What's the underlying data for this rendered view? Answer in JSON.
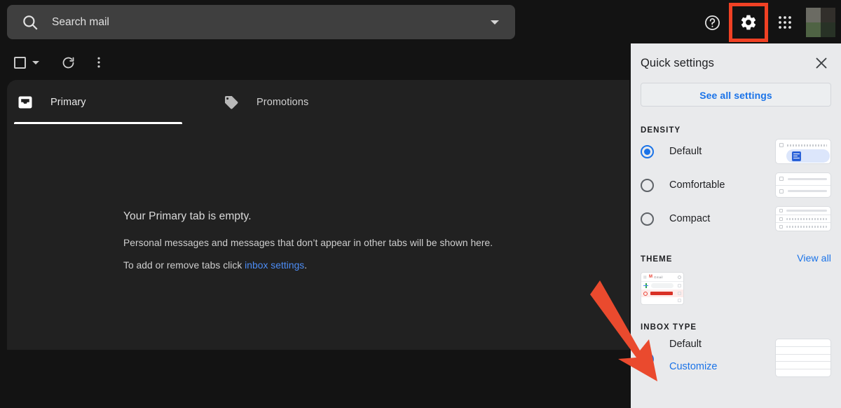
{
  "topbar": {
    "search": {
      "placeholder": "Search mail",
      "value": "",
      "icon": "search-icon"
    },
    "search_options_icon": "chevron-down-icon",
    "help_icon": "help-circle-icon",
    "settings_icon": "gear-icon",
    "apps_icon": "apps-grid-icon",
    "avatar_label": "",
    "highlight_color": "#f04124"
  },
  "toolbar": {
    "select_all_icon": "checkbox-icon",
    "select_all_caret_icon": "chevron-down-icon",
    "refresh_icon": "refresh-icon",
    "more_icon": "more-vertical-icon"
  },
  "tabs": [
    {
      "label": "Primary",
      "icon": "inbox-icon",
      "active": true
    },
    {
      "label": "Promotions",
      "icon": "tag-icon",
      "active": false
    }
  ],
  "empty_state": {
    "title": "Your Primary tab is empty.",
    "line2": "Personal messages and messages that don’t appear in other tabs will be shown here.",
    "line3_prefix": "To add or remove tabs click ",
    "line3_link": "inbox settings",
    "line3_suffix": "."
  },
  "quick_settings": {
    "title": "Quick settings",
    "close_icon": "close-icon",
    "see_all_label": "See all settings",
    "density": {
      "label": "DENSITY",
      "options": [
        {
          "label": "Default",
          "selected": true
        },
        {
          "label": "Comfortable",
          "selected": false
        },
        {
          "label": "Compact",
          "selected": false
        }
      ]
    },
    "theme": {
      "label": "THEME",
      "view_all_label": "View all",
      "preview_brand": "M",
      "preview_name": "Gmail"
    },
    "inbox_type": {
      "label": "INBOX TYPE",
      "option_label": "Default",
      "customize_label": "Customize",
      "selected": true
    },
    "accent_color": "#1a73e8",
    "panel_background": "#e9eaec"
  },
  "annotation": {
    "arrow_color": "#ea4a2e",
    "points_to": "inbox-type-default-radio"
  }
}
